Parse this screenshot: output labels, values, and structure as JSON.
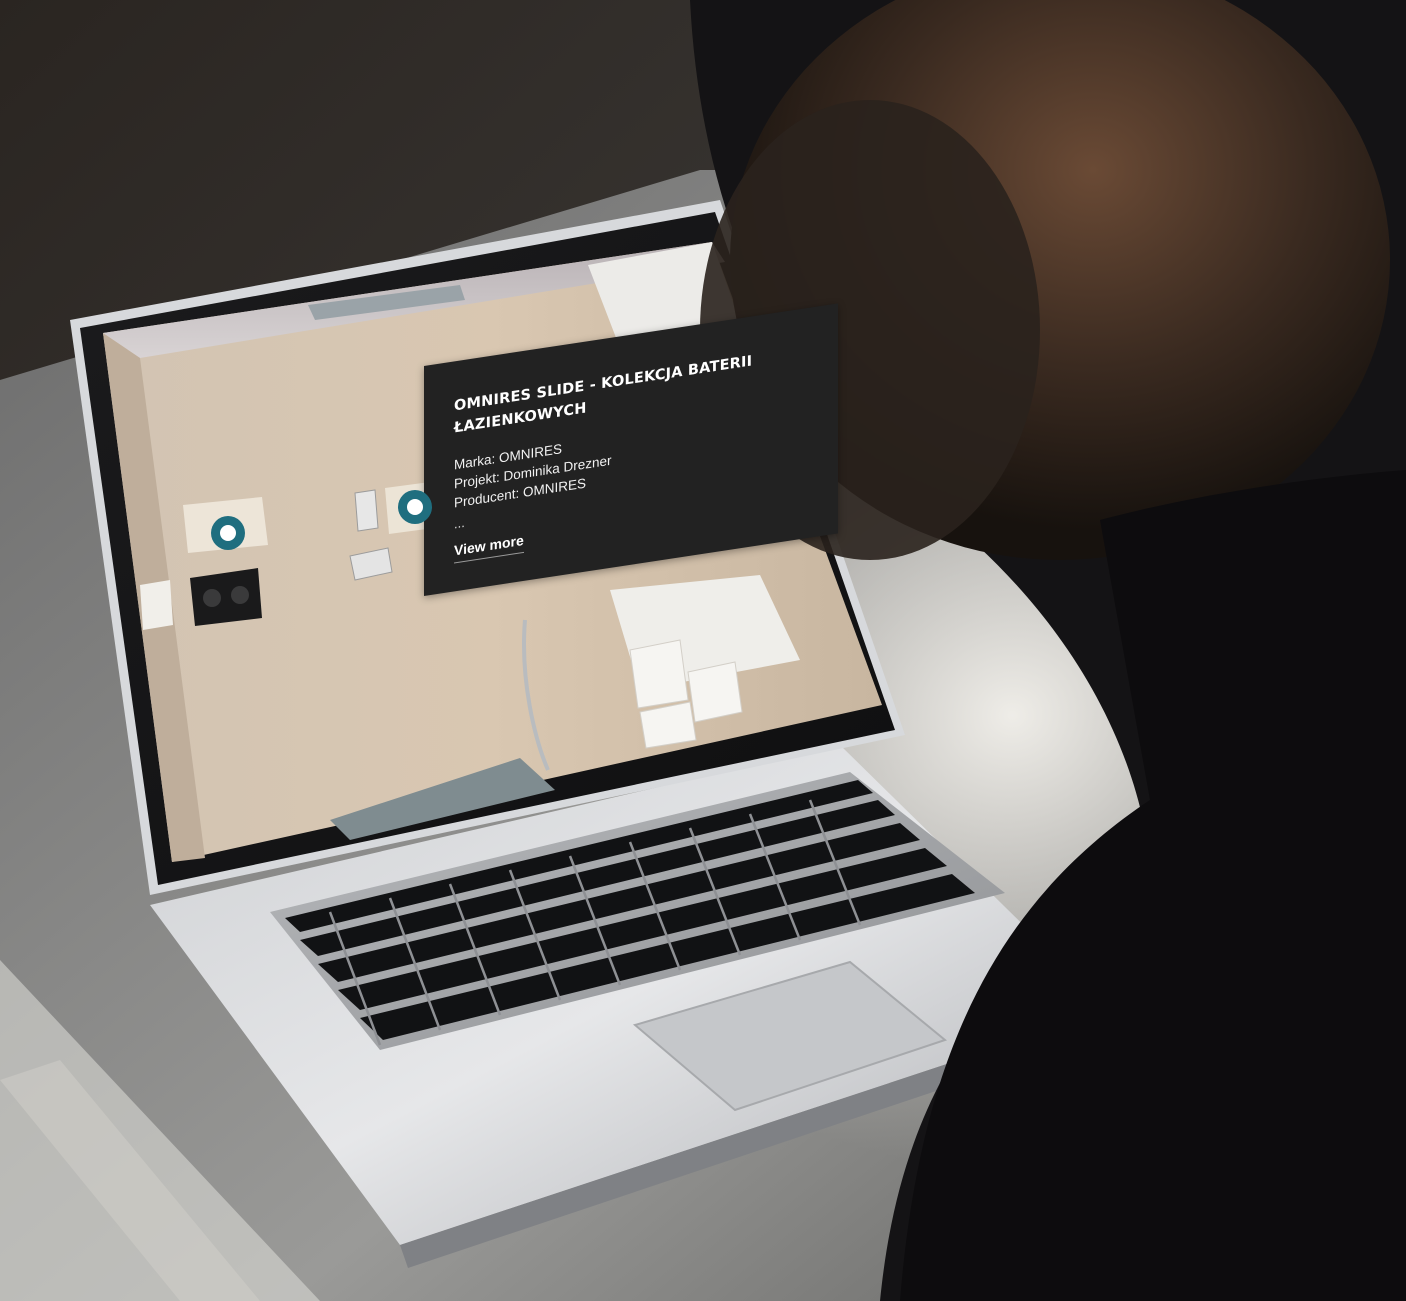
{
  "popup": {
    "title": "OMNIRES SLIDE - KOLEKCJA BATERII ŁAZIENKOWYCH",
    "details": [
      "Marka: OMNIRES",
      "Projekt: Dominika Drezner",
      "Producent: OMNIRES"
    ],
    "ellipsis": "...",
    "view_more_label": "View more"
  },
  "icons": {
    "share": "share-icon",
    "panel_toggle": "panel-toggle-icon",
    "hotspot": "hotspot-marker-icon"
  },
  "colors": {
    "popup_background": "#222222",
    "hotspot": "#1f6e7f",
    "hotspot_center": "#ffffff"
  }
}
